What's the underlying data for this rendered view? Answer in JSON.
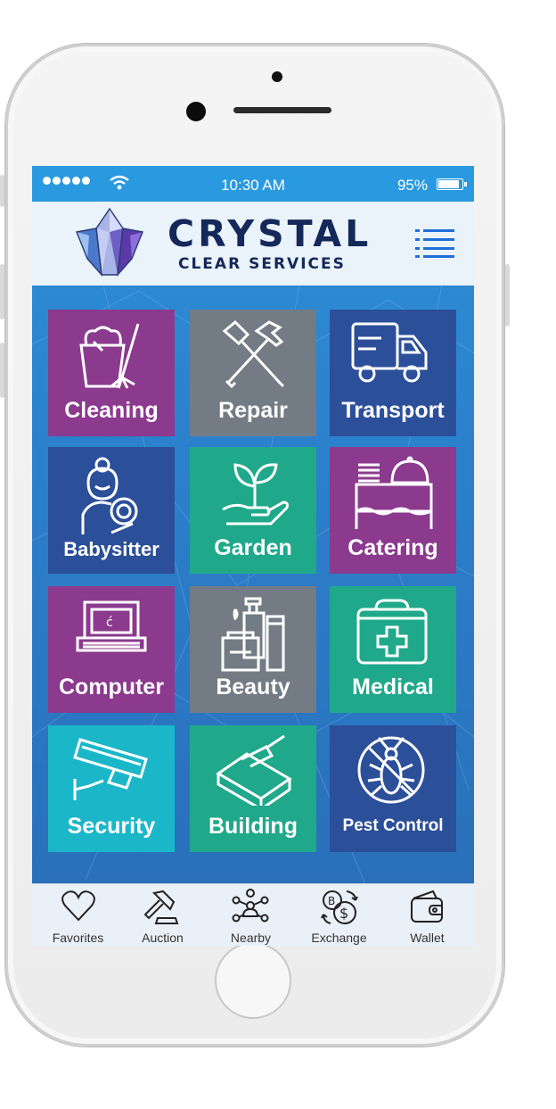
{
  "status_bar": {
    "time": "10:30 AM",
    "battery": "95%"
  },
  "header": {
    "brand_line1": "CRYSTAL",
    "brand_line2": "CLEAR SERVICES"
  },
  "services": [
    {
      "label": "Cleaning",
      "icon": "cleaning-bucket-mop-icon",
      "color": "#8b3a8e"
    },
    {
      "label": "Repair",
      "icon": "hammer-screwdriver-icon",
      "color": "#737c84"
    },
    {
      "label": "Transport",
      "icon": "truck-icon",
      "color": "#2c4f9a"
    },
    {
      "label": "Babysitter",
      "icon": "babysitter-icon",
      "color": "#2c4f9a"
    },
    {
      "label": "Garden",
      "icon": "plant-hand-icon",
      "color": "#1fa98a"
    },
    {
      "label": "Catering",
      "icon": "catering-cart-icon",
      "color": "#8b3a8e"
    },
    {
      "label": "Computer",
      "icon": "laptop-icon",
      "color": "#8b3a8e"
    },
    {
      "label": "Beauty",
      "icon": "cosmetics-icon",
      "color": "#737c84"
    },
    {
      "label": "Medical",
      "icon": "medical-kit-icon",
      "color": "#1fa98a"
    },
    {
      "label": "Security",
      "icon": "security-camera-icon",
      "color": "#1bb7c8"
    },
    {
      "label": "Building",
      "icon": "brick-trowel-icon",
      "color": "#1fa98a"
    },
    {
      "label": "Pest Control",
      "icon": "no-cockroach-icon",
      "color": "#2c4f9a"
    }
  ],
  "tabs": [
    {
      "label": "Favorites",
      "icon": "heart-icon"
    },
    {
      "label": "Auction",
      "icon": "gavel-icon"
    },
    {
      "label": "Nearby",
      "icon": "people-network-icon"
    },
    {
      "label": "Exchange",
      "icon": "currency-exchange-icon"
    },
    {
      "label": "Wallet",
      "icon": "wallet-icon"
    }
  ]
}
